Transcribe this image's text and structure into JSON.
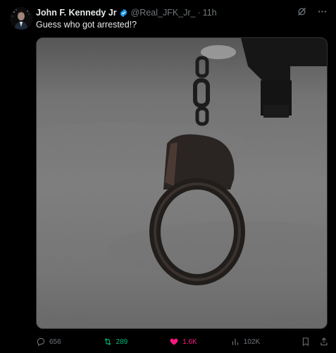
{
  "author": {
    "display_name": "John F. Kennedy Jr",
    "handle": "@Real_JFK_Jr_",
    "separator": "·",
    "time": "11h",
    "verified": true,
    "verified_color": "#1d9bf0"
  },
  "tweet": {
    "text": "Guess who got arrested!?"
  },
  "metrics": {
    "replies": "656",
    "retweets": "289",
    "likes": "1.6K",
    "views": "102K"
  },
  "colors": {
    "background": "#000000",
    "text": "#e7e9ea",
    "muted": "#71767b",
    "retweet_active": "#00ba7c",
    "like_active": "#f91880"
  },
  "icons": {
    "reply": "reply-icon",
    "retweet": "retweet-icon",
    "like": "heart-icon",
    "views": "views-icon",
    "bookmark": "bookmark-icon",
    "share": "share-icon",
    "grok": "grok-icon",
    "more": "more-icon"
  }
}
